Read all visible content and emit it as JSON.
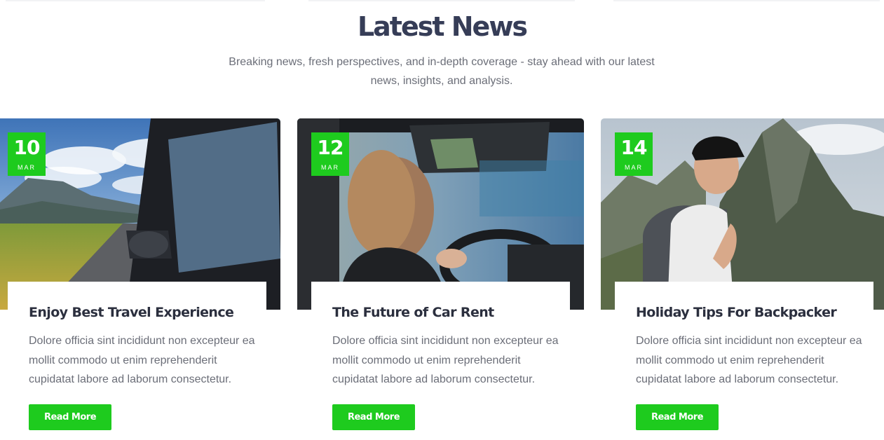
{
  "section": {
    "title": "Latest News",
    "subtitle": "Breaking news, fresh perspectives, and in-depth coverage - stay ahead with our latest news, insights, and analysis."
  },
  "posts": [
    {
      "day": "10",
      "month": "MAR",
      "title": "Enjoy Best Travel Experience",
      "excerpt": "Dolore officia sint incididunt non excepteur ea mollit commodo ut enim reprehenderit cupidatat labore ad laborum consectetur.",
      "button": "Read More",
      "image": "car-window-mountain-road"
    },
    {
      "day": "12",
      "month": "MAR",
      "title": "The Future of Car Rent",
      "excerpt": "Dolore officia sint incididunt non excepteur ea mollit commodo ut enim reprehenderit cupidatat labore ad laborum consectetur.",
      "button": "Read More",
      "image": "woman-driving-car"
    },
    {
      "day": "14",
      "month": "MAR",
      "title": "Holiday Tips For Backpacker",
      "excerpt": "Dolore officia sint incididunt non excepteur ea mollit commodo ut enim reprehenderit cupidatat labore ad laborum consectetur.",
      "button": "Read More",
      "image": "backpacker-mountains"
    }
  ],
  "colors": {
    "accent": "#1ecb1e",
    "heading": "#363d57",
    "body_text": "#6b6e78"
  }
}
